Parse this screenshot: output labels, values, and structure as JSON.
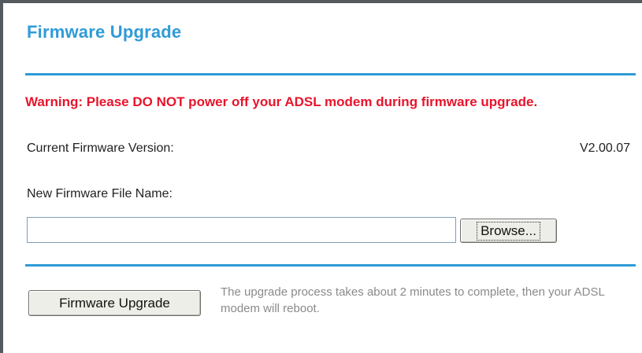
{
  "colors": {
    "accent": "#2f9bd6",
    "warning": "#e8142b"
  },
  "page": {
    "title": "Firmware Upgrade",
    "warning": "Warning: Please DO NOT power off your ADSL modem during firmware upgrade."
  },
  "current_firmware": {
    "label": "Current Firmware Version:",
    "value": "V2.00.07"
  },
  "new_firmware": {
    "label": "New Firmware File Name:",
    "input_value": "",
    "browse_label": "Browse..."
  },
  "actions": {
    "upgrade_label": "Firmware Upgrade",
    "note": "The upgrade process takes about 2 minutes to complete, then your ADSL modem will reboot."
  }
}
